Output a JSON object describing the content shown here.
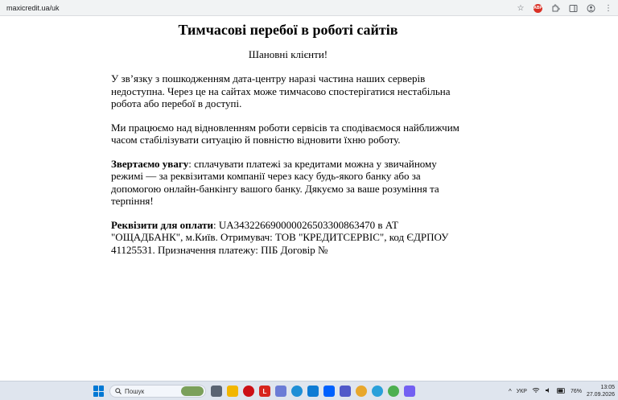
{
  "browser": {
    "url": "maxicredit.ua/uk"
  },
  "page": {
    "title": "Тимчасові перебої в роботі сайтів",
    "greeting": "Шановні клієнти!",
    "para1": "У зв’язку з пошкодженням дата-центру наразі частина наших серверів недоступна. Через це на сайтах може тимчасово спостерігатися нестабільна робота або перебої в доступі.",
    "para2": "Ми працюємо над відновленням роботи сервісів та сподіваємося найближчим часом стабілізувати ситуацію й повністю відновити їхню роботу.",
    "para3_bold": "Звертаємо увагу",
    "para3_text": ": сплачувати платежі за кредитами можна у звичайному режимі — за реквізитами компанії через касу будь-якого банку або за допомогою онлайн-банкінгу вашого банку. Дякуємо за ваше розуміння та терпіння!",
    "para4_bold": "Реквізити для оплати",
    "para4_text": ": UA343226690000026503300863470 в АТ \"ОЩАДБАНК\", м.Київ. Отримувач: ТОВ \"КРЕДИТСЕРВІС\", код ЄДРПОУ 41125531. Призначення платежу: ПІБ Договір №"
  },
  "taskbar": {
    "search_placeholder": "Пошук",
    "language": "УКР",
    "battery": "76%",
    "time": "13:05",
    "date": "27.09.2026"
  },
  "icons": {
    "abp_text": "ABP"
  }
}
